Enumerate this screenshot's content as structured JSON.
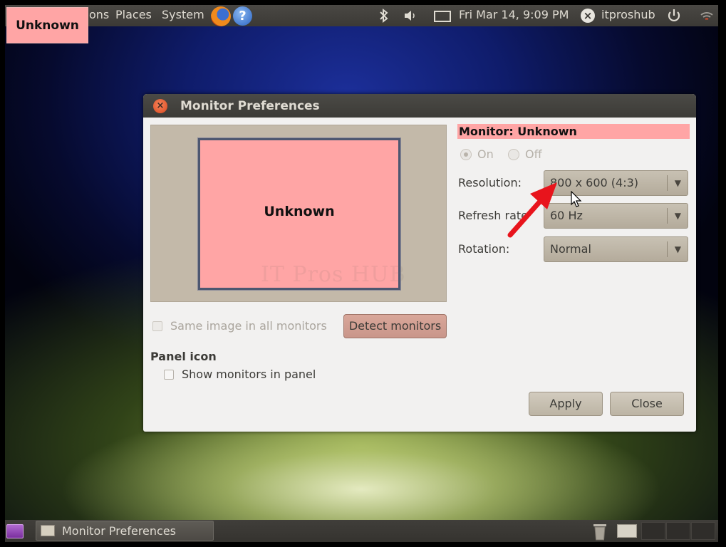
{
  "top_panel": {
    "menu_applications_fragment": "ons",
    "menu_places": "Places",
    "menu_system": "System",
    "datetime": "Fri Mar 14,  9:09 PM",
    "username": "itproshub",
    "icons": [
      "firefox-icon",
      "help-icon",
      "bluetooth-icon",
      "volume-icon",
      "mail-icon",
      "user-icon",
      "power-icon",
      "network-icon"
    ]
  },
  "overlay_tag": "Unknown",
  "dialog": {
    "title": "Monitor Preferences",
    "preview_monitor_label": "Unknown",
    "watermark": "IT Pros HUB",
    "monitor_heading": "Monitor: Unknown",
    "power": {
      "on_label": "On",
      "off_label": "Off",
      "selected": "On"
    },
    "resolution": {
      "label": "Resolution:",
      "value": "800 x 600 (4:3)"
    },
    "refresh_rate": {
      "label": "Refresh rate",
      "value": "60 Hz"
    },
    "rotation": {
      "label": "Rotation:",
      "value": "Normal"
    },
    "same_image_label": "Same image in all monitors",
    "detect_button": "Detect monitors",
    "panel_icon_heading": "Panel icon",
    "show_monitors_label": "Show monitors in panel",
    "apply_button": "Apply",
    "close_button": "Close"
  },
  "taskbar": {
    "task_label": "Monitor Preferences"
  },
  "colors": {
    "highlight_pink": "#ffa5a5",
    "panel_dark": "#3c3b37",
    "dialog_bg": "#f2f1f0",
    "annotation_red": "#e8141c"
  }
}
